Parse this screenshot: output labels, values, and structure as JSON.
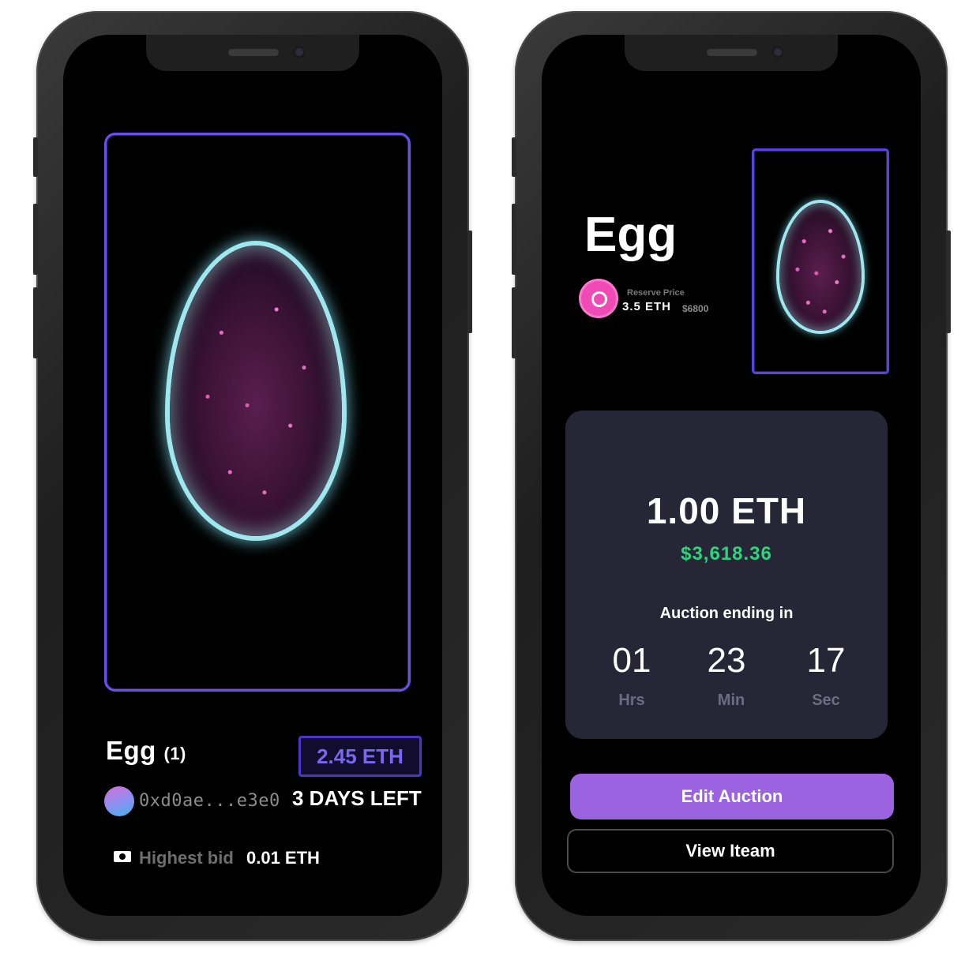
{
  "left_screen": {
    "item_name": "Egg",
    "item_count": "(1)",
    "price": "2.45 ETH",
    "owner_address": "0xd0ae...e3e0",
    "time_left": "3 DAYS LEFT",
    "highest_bid_label": "Highest bid",
    "highest_bid_value": "0.01 ETH"
  },
  "right_screen": {
    "item_name": "Egg",
    "reserve_label": "Reserve Price",
    "reserve_eth": "3.5 ETH",
    "reserve_usd": "$6800",
    "current_bid_eth": "1.00 ETH",
    "current_bid_usd": "$3,618.36",
    "auction_label": "Auction ending in",
    "countdown": [
      {
        "value": "01",
        "unit": "Hrs"
      },
      {
        "value": "23",
        "unit": "Min"
      },
      {
        "value": "17",
        "unit": "Sec"
      }
    ],
    "edit_button": "Edit Auction",
    "view_button": "View Iteam"
  },
  "colors": {
    "accent_purple": "#9b63e0",
    "frame_border": "#6b4df2",
    "usd_green": "#2ed47c",
    "reserve_pink": "#f04bb4",
    "card_bg": "#262637"
  }
}
